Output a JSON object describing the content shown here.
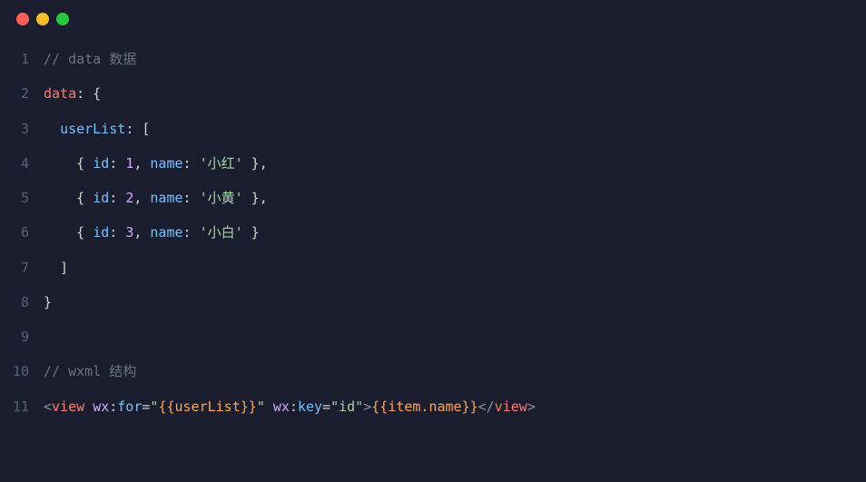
{
  "code": {
    "lines": [
      {
        "n": "1",
        "segments": [
          {
            "cls": "tok-comment",
            "t": "// data 数据"
          }
        ]
      },
      {
        "n": "2",
        "segments": [
          {
            "cls": "tok-key",
            "t": "data"
          },
          {
            "cls": "tok-punct",
            "t": ": {"
          }
        ]
      },
      {
        "n": "3",
        "segments": [
          {
            "cls": "",
            "t": "  "
          },
          {
            "cls": "tok-prop",
            "t": "userList"
          },
          {
            "cls": "tok-punct",
            "t": ": ["
          }
        ]
      },
      {
        "n": "4",
        "segments": [
          {
            "cls": "",
            "t": "    { "
          },
          {
            "cls": "tok-prop",
            "t": "id"
          },
          {
            "cls": "tok-punct",
            "t": ": "
          },
          {
            "cls": "tok-number",
            "t": "1"
          },
          {
            "cls": "tok-punct",
            "t": ", "
          },
          {
            "cls": "tok-prop",
            "t": "name"
          },
          {
            "cls": "tok-punct",
            "t": ": "
          },
          {
            "cls": "tok-string",
            "t": "'小红'"
          },
          {
            "cls": "tok-punct",
            "t": " },"
          }
        ]
      },
      {
        "n": "5",
        "segments": [
          {
            "cls": "",
            "t": "    { "
          },
          {
            "cls": "tok-prop",
            "t": "id"
          },
          {
            "cls": "tok-punct",
            "t": ": "
          },
          {
            "cls": "tok-number",
            "t": "2"
          },
          {
            "cls": "tok-punct",
            "t": ", "
          },
          {
            "cls": "tok-prop",
            "t": "name"
          },
          {
            "cls": "tok-punct",
            "t": ": "
          },
          {
            "cls": "tok-string",
            "t": "'小黄'"
          },
          {
            "cls": "tok-punct",
            "t": " },"
          }
        ]
      },
      {
        "n": "6",
        "segments": [
          {
            "cls": "",
            "t": "    { "
          },
          {
            "cls": "tok-prop",
            "t": "id"
          },
          {
            "cls": "tok-punct",
            "t": ": "
          },
          {
            "cls": "tok-number",
            "t": "3"
          },
          {
            "cls": "tok-punct",
            "t": ", "
          },
          {
            "cls": "tok-prop",
            "t": "name"
          },
          {
            "cls": "tok-punct",
            "t": ": "
          },
          {
            "cls": "tok-string",
            "t": "'小白'"
          },
          {
            "cls": "tok-punct",
            "t": " }"
          }
        ]
      },
      {
        "n": "7",
        "segments": [
          {
            "cls": "tok-punct",
            "t": "  ]"
          }
        ]
      },
      {
        "n": "8",
        "segments": [
          {
            "cls": "tok-punct",
            "t": "}"
          }
        ]
      },
      {
        "n": "9",
        "segments": [
          {
            "cls": "",
            "t": ""
          }
        ]
      },
      {
        "n": "10",
        "segments": [
          {
            "cls": "tok-comment",
            "t": "// wxml 结构"
          }
        ]
      },
      {
        "n": "11",
        "segments": [
          {
            "cls": "tok-angle",
            "t": "<"
          },
          {
            "cls": "tok-tag",
            "t": "view"
          },
          {
            "cls": "",
            "t": " "
          },
          {
            "cls": "tok-attrns",
            "t": "wx"
          },
          {
            "cls": "tok-punct",
            "t": ":"
          },
          {
            "cls": "tok-attr",
            "t": "for"
          },
          {
            "cls": "tok-punct",
            "t": "="
          },
          {
            "cls": "tok-attrval",
            "t": "\""
          },
          {
            "cls": "tok-binding",
            "t": "{{"
          },
          {
            "cls": "tok-binding-inner",
            "t": "userList"
          },
          {
            "cls": "tok-binding",
            "t": "}}"
          },
          {
            "cls": "tok-attrval",
            "t": "\""
          },
          {
            "cls": "",
            "t": " "
          },
          {
            "cls": "tok-attrns",
            "t": "wx"
          },
          {
            "cls": "tok-punct",
            "t": ":"
          },
          {
            "cls": "tok-attr",
            "t": "key"
          },
          {
            "cls": "tok-punct",
            "t": "="
          },
          {
            "cls": "tok-attrval",
            "t": "\"id\""
          },
          {
            "cls": "tok-angle",
            "t": ">"
          },
          {
            "cls": "tok-binding",
            "t": "{{"
          },
          {
            "cls": "tok-binding-inner",
            "t": "item.name"
          },
          {
            "cls": "tok-binding",
            "t": "}}"
          },
          {
            "cls": "tok-angle",
            "t": "</"
          },
          {
            "cls": "tok-tag",
            "t": "view"
          },
          {
            "cls": "tok-angle",
            "t": ">"
          }
        ]
      }
    ]
  }
}
